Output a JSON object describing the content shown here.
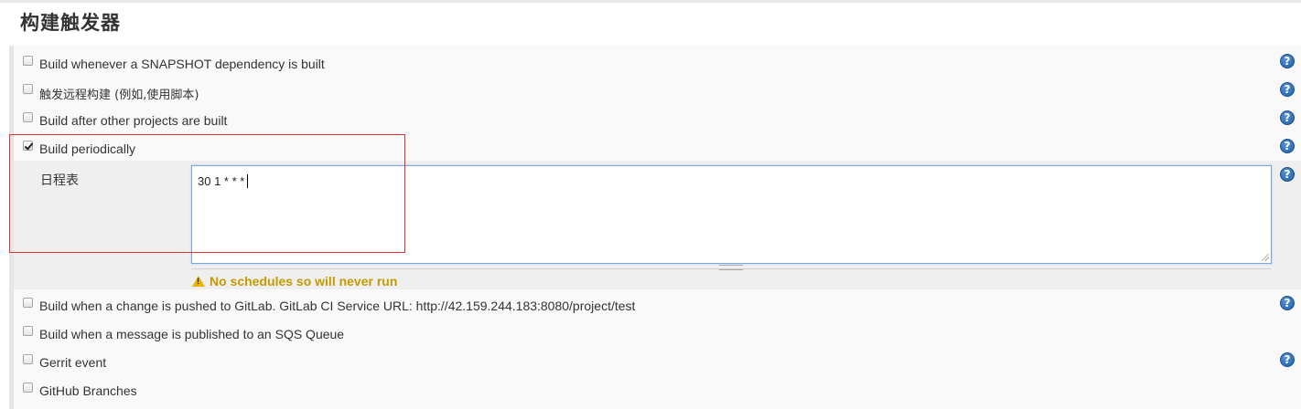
{
  "section": {
    "title": "构建触发器"
  },
  "triggers": [
    {
      "label": "Build whenever a SNAPSHOT dependency is built",
      "checked": false,
      "help": true
    },
    {
      "label": "触发远程构建 (例如,使用脚本)",
      "checked": false,
      "help": true
    },
    {
      "label": "Build after other projects are built",
      "checked": false,
      "help": true
    },
    {
      "label": "Build periodically",
      "checked": true,
      "help": true
    },
    {
      "label": "Build when a change is pushed to GitLab. GitLab CI Service URL: http://42.159.244.183:8080/project/test",
      "checked": false,
      "help": true
    },
    {
      "label": "Build when a message is published to an SQS Queue",
      "checked": false,
      "help": false
    },
    {
      "label": "Gerrit event",
      "checked": false,
      "help": true
    },
    {
      "label": "GitHub Branches",
      "checked": false,
      "help": false
    }
  ],
  "schedule": {
    "label": "日程表",
    "value": "30 1 * * *",
    "warning": "No schedules so will never run"
  },
  "icons": {
    "help": "help-icon",
    "warning": "warning-icon"
  },
  "colors": {
    "warning_text": "#c49a00",
    "help_blue": "#1d5ea8",
    "highlight_border": "#e03030",
    "focus_border": "#7aa7e0"
  }
}
